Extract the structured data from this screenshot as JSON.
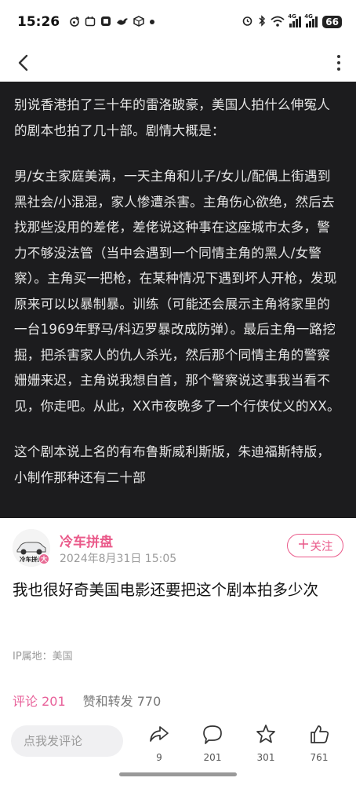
{
  "status_bar": {
    "time": "15:26",
    "left_icons": [
      "weibo-icon",
      "calendar-icon",
      "tieba-icon",
      "bird-icon",
      "cube-icon",
      "dot-icon"
    ],
    "right_icons": [
      "alarm-icon",
      "bluetooth-icon",
      "wifi-icon",
      "signal-4g-icon",
      "signal-4g-icon"
    ],
    "network_labels": [
      "4G",
      "4G"
    ],
    "battery": "66"
  },
  "nav": {
    "back_icon": "chevron-left-icon",
    "more_icon": "more-vertical-icon"
  },
  "quote": {
    "paragraphs": [
      "别说香港拍了三十年的雷洛跛豪，美国人拍什么伸冤人的剧本也拍了几十部。剧情大概是：",
      "男/女主家庭美满，一天主角和儿子/女儿/配偶上街遇到黑社会/小混混，家人惨遭杀害。主角伤心欲绝，然后去找那些没用的差佬，差佬说这种事在这座城市太多，警力不够没法管（当中会遇到一个同情主角的黑人/女警察）。主角买一把枪，在某种情况下遇到坏人开枪，发现原来可以以暴制暴。训练（可能还会展示主角将家里的一台1969年野马/科迈罗暴改成防弹）。最后主角一路挖掘，把杀害家人的仇人杀光，然后那个同情主角的警察姗姗来迟，主角说我想自首，那个警察说这事我当看不见，你走吧。从此，XX市夜晚多了一个行侠仗义的XX。",
      "这个剧本说上名的有布鲁斯威利斯版，朱迪福斯特版，小制作那种还有二十部"
    ]
  },
  "author": {
    "avatar_caption": "冷车拼盘",
    "badge": "大",
    "name": "冷车拼盘",
    "time": "2024年8月31日 15:05",
    "follow_label": "关注"
  },
  "post": {
    "body": "我也很好奇美国电影还要把这个剧本拍多少次",
    "ip_location": "IP属地：美国"
  },
  "stats": {
    "comments_label": "评论 201",
    "reposts_label": "赞和转发 770"
  },
  "bottom_bar": {
    "comment_placeholder": "点我发评论",
    "share_count": "9",
    "comment_count": "201",
    "favorite_count": "301",
    "like_count": "761"
  },
  "colors": {
    "accent": "#ea5a8a",
    "dark_block": "#1c1c1e",
    "text_light": "#e6e6e6",
    "muted": "#9a9a9a"
  }
}
